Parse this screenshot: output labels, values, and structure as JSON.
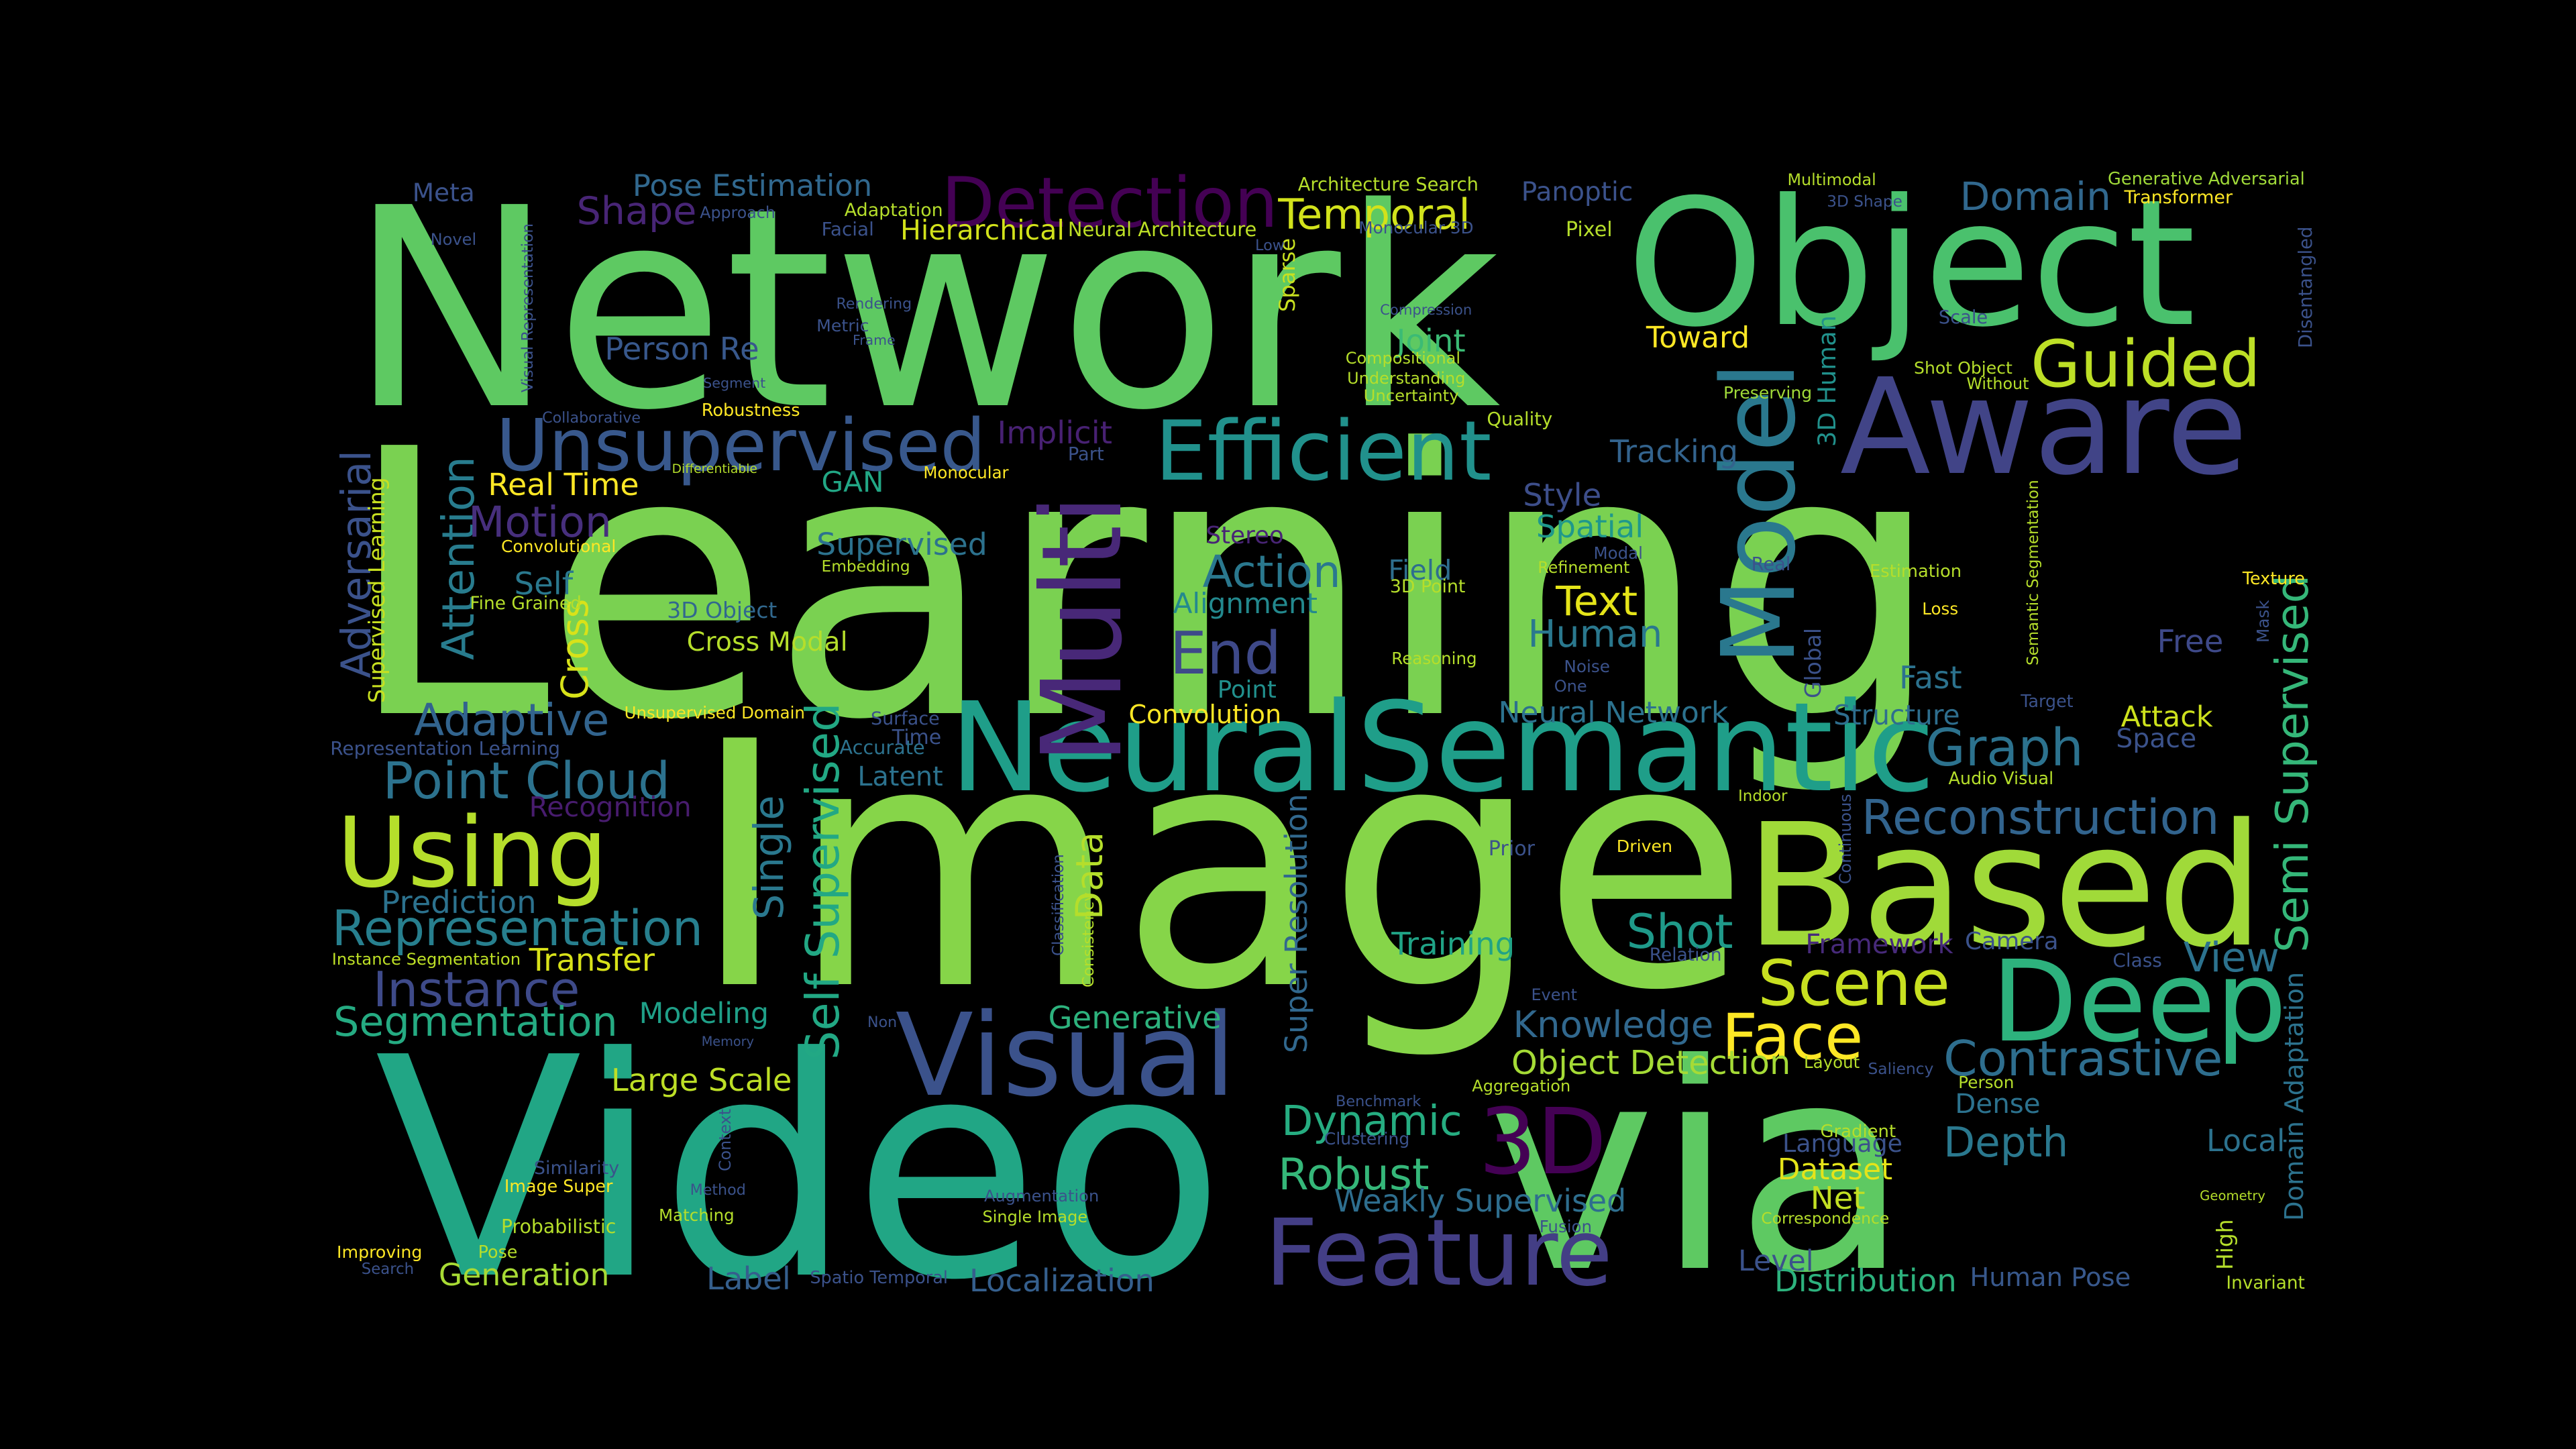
{
  "background_color": "#000000",
  "palette": "viridis",
  "words": [
    {
      "text": "Learning",
      "color": "#7ad151"
    },
    {
      "text": "Image",
      "color": "#86d549"
    },
    {
      "text": "Network",
      "color": "#5ec962"
    },
    {
      "text": "Video",
      "color": "#21a685"
    },
    {
      "text": "via",
      "color": "#5ec962"
    },
    {
      "text": "Object",
      "color": "#4ac16d"
    },
    {
      "text": "Based",
      "color": "#a0da39"
    },
    {
      "text": "Aware",
      "color": "#414487"
    },
    {
      "text": "NeuralSemantic",
      "color": "#1f9e89"
    },
    {
      "text": "Deep",
      "color": "#2db27d"
    },
    {
      "text": "Visual",
      "color": "#3b528b"
    },
    {
      "text": "Feature",
      "color": "#433e85"
    },
    {
      "text": "Using",
      "color": "#b5de2b"
    },
    {
      "text": "3D",
      "color": "#440154"
    },
    {
      "text": "Efficient",
      "color": "#21918c"
    },
    {
      "text": "Model",
      "color": "#2a788e"
    },
    {
      "text": "Multi",
      "color": "#482878"
    },
    {
      "text": "Unsupervised",
      "color": "#38588c"
    },
    {
      "text": "Guided",
      "color": "#bddf26"
    },
    {
      "text": "Detection",
      "color": "#440154"
    },
    {
      "text": "Scene",
      "color": "#c8e020"
    },
    {
      "text": "Face",
      "color": "#fde725"
    },
    {
      "text": "Contrastive",
      "color": "#2e6e8e"
    },
    {
      "text": "Reconstruction",
      "color": "#32648e"
    },
    {
      "text": "Representation",
      "color": "#277f8e"
    },
    {
      "text": "Domain",
      "color": "#31688e"
    },
    {
      "text": "Temporal",
      "color": "#d2e21b"
    },
    {
      "text": "Shot",
      "color": "#1f9a8a"
    },
    {
      "text": "Graph",
      "color": "#2c728e"
    },
    {
      "text": "Point Cloud",
      "color": "#2c728e"
    },
    {
      "text": "Instance",
      "color": "#3e4a89"
    },
    {
      "text": "Segmentation",
      "color": "#25ab82"
    },
    {
      "text": "Self Supervised",
      "color": "#22a884"
    },
    {
      "text": "Semi Supervised",
      "color": "#35b779"
    },
    {
      "text": "End",
      "color": "#3e4989"
    },
    {
      "text": "Human",
      "color": "#2a788e"
    },
    {
      "text": "Action",
      "color": "#2a788e"
    },
    {
      "text": "Text",
      "color": "#e5e419"
    },
    {
      "text": "Adaptive",
      "color": "#32648e"
    },
    {
      "text": "Adversarial",
      "color": "#3b528b"
    },
    {
      "text": "Attention",
      "color": "#287c8e"
    },
    {
      "text": "Dynamic",
      "color": "#26ad81"
    },
    {
      "text": "Robust",
      "color": "#35b779"
    },
    {
      "text": "Depth",
      "color": "#2a788e"
    },
    {
      "text": "Knowledge",
      "color": "#31688e"
    },
    {
      "text": "Object Detection",
      "color": "#a5db36"
    },
    {
      "text": "Weakly Supervised",
      "color": "#2e6e8e"
    },
    {
      "text": "Super Resolution",
      "color": "#31688e"
    },
    {
      "text": "Motion",
      "color": "#472f7d"
    },
    {
      "text": "Shape",
      "color": "#482576"
    },
    {
      "text": "Pose Estimation",
      "color": "#31688e"
    },
    {
      "text": "Generative",
      "color": "#2db27d"
    },
    {
      "text": "Transfer",
      "color": "#d8e219"
    },
    {
      "text": "Prediction",
      "color": "#2c728e"
    },
    {
      "text": "Modeling",
      "color": "#1fa088"
    },
    {
      "text": "Large Scale",
      "color": "#bddf26"
    },
    {
      "text": "Localization",
      "color": "#355f8d"
    },
    {
      "text": "Generation",
      "color": "#a8db34"
    },
    {
      "text": "Distribution",
      "color": "#2db27d"
    },
    {
      "text": "Human Pose",
      "color": "#38588c"
    },
    {
      "text": "Hierarchical",
      "color": "#d2e21b"
    },
    {
      "text": "Neural Architecture",
      "color": "#bddf26"
    },
    {
      "text": "Person Re",
      "color": "#38588c"
    },
    {
      "text": "Joint",
      "color": "#3bbb75"
    },
    {
      "text": "Toward",
      "color": "#fde725"
    },
    {
      "text": "Tracking",
      "color": "#33638d"
    },
    {
      "text": "Style",
      "color": "#3d4e8a"
    },
    {
      "text": "Spatial",
      "color": "#1f988b"
    },
    {
      "text": "Field",
      "color": "#2e6e8e"
    },
    {
      "text": "Alignment",
      "color": "#23898e"
    },
    {
      "text": "Point",
      "color": "#21908d"
    },
    {
      "text": "Convolution",
      "color": "#fde725"
    },
    {
      "text": "Neural Network",
      "color": "#2c728e"
    },
    {
      "text": "Structure",
      "color": "#2e6e8e"
    },
    {
      "text": "Fast",
      "color": "#2c728e"
    },
    {
      "text": "Free",
      "color": "#3e4989"
    },
    {
      "text": "Attack",
      "color": "#cde11d"
    },
    {
      "text": "Space",
      "color": "#3b528b"
    },
    {
      "text": "Framework",
      "color": "#472a7a"
    },
    {
      "text": "Camera",
      "color": "#3b528b"
    },
    {
      "text": "View",
      "color": "#2c728e"
    },
    {
      "text": "Dense",
      "color": "#2c728e"
    },
    {
      "text": "Local",
      "color": "#2c728e"
    },
    {
      "text": "Language",
      "color": "#3b528b"
    },
    {
      "text": "Dataset",
      "color": "#e5e419"
    },
    {
      "text": "Net",
      "color": "#c2df23"
    },
    {
      "text": "Level",
      "color": "#3b528b"
    },
    {
      "text": "Label",
      "color": "#355f8d"
    },
    {
      "text": "Real Time",
      "color": "#fde725"
    },
    {
      "text": "Self",
      "color": "#2a788e"
    },
    {
      "text": "3D Object",
      "color": "#31688e"
    },
    {
      "text": "Cross Modal",
      "color": "#b5de2b"
    },
    {
      "text": "Cross",
      "color": "#d8e219"
    },
    {
      "text": "Supervised",
      "color": "#2c728e"
    },
    {
      "text": "Implicit",
      "color": "#482173"
    },
    {
      "text": "GAN",
      "color": "#22a785"
    },
    {
      "text": "Single",
      "color": "#2a788e"
    },
    {
      "text": "Data",
      "color": "#b5de2b"
    },
    {
      "text": "Accurate",
      "color": "#2c728e"
    },
    {
      "text": "Latent",
      "color": "#2c728e"
    },
    {
      "text": "Time",
      "color": "#3b528b"
    },
    {
      "text": "Recognition",
      "color": "#481c6e"
    },
    {
      "text": "Training",
      "color": "#20a386"
    },
    {
      "text": "Meta",
      "color": "#3b528b"
    },
    {
      "text": "Panoptic",
      "color": "#3b528b"
    },
    {
      "text": "3D Human",
      "color": "#21918c"
    },
    {
      "text": "Supervised Learning",
      "color": "#c8e020"
    },
    {
      "text": "Unsupervised Domain",
      "color": "#fde725"
    },
    {
      "text": "Instance Segmentation",
      "color": "#bddf26"
    },
    {
      "text": "Representation Learning",
      "color": "#3b528b"
    },
    {
      "text": "Domain Adaptation",
      "color": "#2c728e"
    },
    {
      "text": "Stereo",
      "color": "#482475"
    },
    {
      "text": "Architecture Search",
      "color": "#b5de2b"
    },
    {
      "text": "Multimodal",
      "color": "#b5de2b"
    },
    {
      "text": "Generative Adversarial",
      "color": "#a0da39"
    },
    {
      "text": "Transformer",
      "color": "#fde725"
    },
    {
      "text": "Disentangled",
      "color": "#3b528b"
    },
    {
      "text": "3D Shape",
      "color": "#3b528b"
    },
    {
      "text": "Monocular 3D",
      "color": "#3b528b"
    },
    {
      "text": "Pixel",
      "color": "#b5de2b"
    },
    {
      "text": "Compression",
      "color": "#3b528b"
    },
    {
      "text": "Compositional",
      "color": "#b5de2b"
    },
    {
      "text": "Understanding",
      "color": "#b5de2b"
    },
    {
      "text": "Uncertainty",
      "color": "#b5de2b"
    },
    {
      "text": "Quality",
      "color": "#b5de2b"
    },
    {
      "text": "Preserving",
      "color": "#a0da39"
    },
    {
      "text": "Shot Object",
      "color": "#b5de2b"
    },
    {
      "text": "Without",
      "color": "#b5de2b"
    },
    {
      "text": "Scale",
      "color": "#3b528b"
    },
    {
      "text": "Adaptation",
      "color": "#b5de2b"
    },
    {
      "text": "Approach",
      "color": "#3b528b"
    },
    {
      "text": "Facial",
      "color": "#3b528b"
    },
    {
      "text": "Novel",
      "color": "#3b528b"
    },
    {
      "text": "Visual Representation",
      "color": "#3b528b"
    },
    {
      "text": "Rendering",
      "color": "#3b528b"
    },
    {
      "text": "Metric",
      "color": "#3b528b"
    },
    {
      "text": "Frame",
      "color": "#3b528b"
    },
    {
      "text": "Segment",
      "color": "#3b528b"
    },
    {
      "text": "Collaborative",
      "color": "#3b528b"
    },
    {
      "text": "Robustness",
      "color": "#fde725"
    },
    {
      "text": "Differentiable",
      "color": "#b5de2b"
    },
    {
      "text": "Monocular",
      "color": "#fde725"
    },
    {
      "text": "Sparse",
      "color": "#c8e020"
    },
    {
      "text": "Low",
      "color": "#3b528b"
    },
    {
      "text": "Part",
      "color": "#3b528b"
    },
    {
      "text": "Convolutional",
      "color": "#fde725"
    },
    {
      "text": "Embedding",
      "color": "#b5de2b"
    },
    {
      "text": "Fine Grained",
      "color": "#b5de2b"
    },
    {
      "text": "Modal",
      "color": "#3b528b"
    },
    {
      "text": "3D Point",
      "color": "#b5de2b"
    },
    {
      "text": "Refinement",
      "color": "#b5de2b"
    },
    {
      "text": "Real",
      "color": "#3b528b"
    },
    {
      "text": "Estimation",
      "color": "#b5de2b"
    },
    {
      "text": "Semantic Segmentation",
      "color": "#b5de2b"
    },
    {
      "text": "Texture",
      "color": "#fde725"
    },
    {
      "text": "Loss",
      "color": "#fde725"
    },
    {
      "text": "Mask",
      "color": "#3b528b"
    },
    {
      "text": "Reasoning",
      "color": "#b5de2b"
    },
    {
      "text": "Noise",
      "color": "#3b528b"
    },
    {
      "text": "One",
      "color": "#3b528b"
    },
    {
      "text": "Global",
      "color": "#3b528b"
    },
    {
      "text": "Surface",
      "color": "#3b528b"
    },
    {
      "text": "Target",
      "color": "#3b528b"
    },
    {
      "text": "Audio Visual",
      "color": "#b5de2b"
    },
    {
      "text": "Indoor",
      "color": "#b5de2b"
    },
    {
      "text": "Continuous",
      "color": "#3b528b"
    },
    {
      "text": "Prior",
      "color": "#3b528b"
    },
    {
      "text": "Driven",
      "color": "#fde725"
    },
    {
      "text": "Classification",
      "color": "#3b528b"
    },
    {
      "text": "Consistency",
      "color": "#b5de2b"
    },
    {
      "text": "Relation",
      "color": "#3b528b"
    },
    {
      "text": "Class",
      "color": "#3b528b"
    },
    {
      "text": "Event",
      "color": "#3b528b"
    },
    {
      "text": "Non",
      "color": "#3b528b"
    },
    {
      "text": "Memory",
      "color": "#3b528b"
    },
    {
      "text": "Layout",
      "color": "#b5de2b"
    },
    {
      "text": "Saliency",
      "color": "#3b528b"
    },
    {
      "text": "Person",
      "color": "#b5de2b"
    },
    {
      "text": "Aggregation",
      "color": "#b5de2b"
    },
    {
      "text": "Benchmark",
      "color": "#3b528b"
    },
    {
      "text": "Clustering",
      "color": "#3b528b"
    },
    {
      "text": "Gradient",
      "color": "#b5de2b"
    },
    {
      "text": "Correspondence",
      "color": "#b5de2b"
    },
    {
      "text": "Fusion",
      "color": "#3b528b"
    },
    {
      "text": "Geometry",
      "color": "#b5de2b"
    },
    {
      "text": "High",
      "color": "#b5de2b"
    },
    {
      "text": "Invariant",
      "color": "#b5de2b"
    },
    {
      "text": "Context",
      "color": "#3b528b"
    },
    {
      "text": "Method",
      "color": "#3b528b"
    },
    {
      "text": "Augmentation",
      "color": "#3b528b"
    },
    {
      "text": "Single Image",
      "color": "#b5de2b"
    },
    {
      "text": "Matching",
      "color": "#b5de2b"
    },
    {
      "text": "Similarity",
      "color": "#3b528b"
    },
    {
      "text": "Image Super",
      "color": "#fde725"
    },
    {
      "text": "Probabilistic",
      "color": "#b5de2b"
    },
    {
      "text": "Improving",
      "color": "#fde725"
    },
    {
      "text": "Pose",
      "color": "#b5de2b"
    },
    {
      "text": "Search",
      "color": "#3b528b"
    },
    {
      "text": "Spatio Temporal",
      "color": "#3b528b"
    }
  ]
}
